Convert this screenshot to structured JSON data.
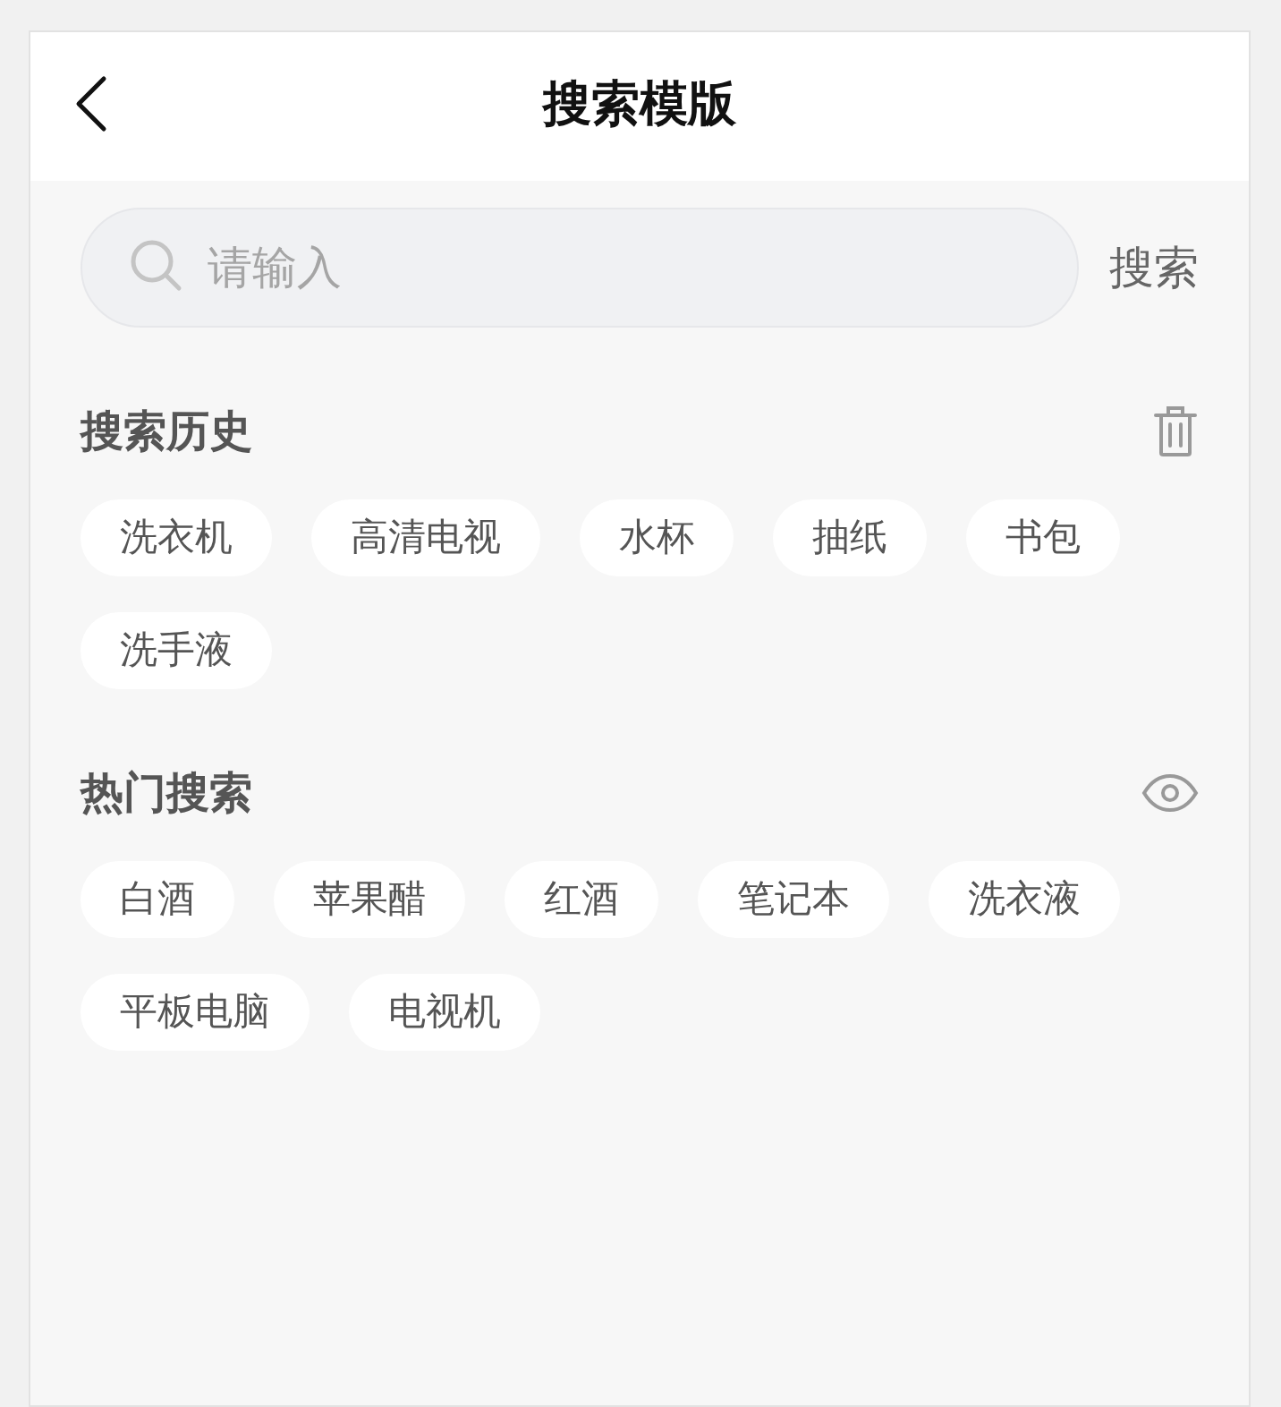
{
  "header": {
    "title": "搜索模版"
  },
  "search": {
    "placeholder": "请输入",
    "button": "搜索"
  },
  "sections": [
    {
      "kind": "history",
      "title": "搜索历史",
      "tags": [
        "洗衣机",
        "高清电视",
        "水杯",
        "抽纸",
        "书包",
        "洗手液"
      ]
    },
    {
      "kind": "hot",
      "title": "热门搜索",
      "tags": [
        "白酒",
        "苹果醋",
        "红酒",
        "笔记本",
        "洗衣液",
        "平板电脑",
        "电视机"
      ]
    }
  ]
}
